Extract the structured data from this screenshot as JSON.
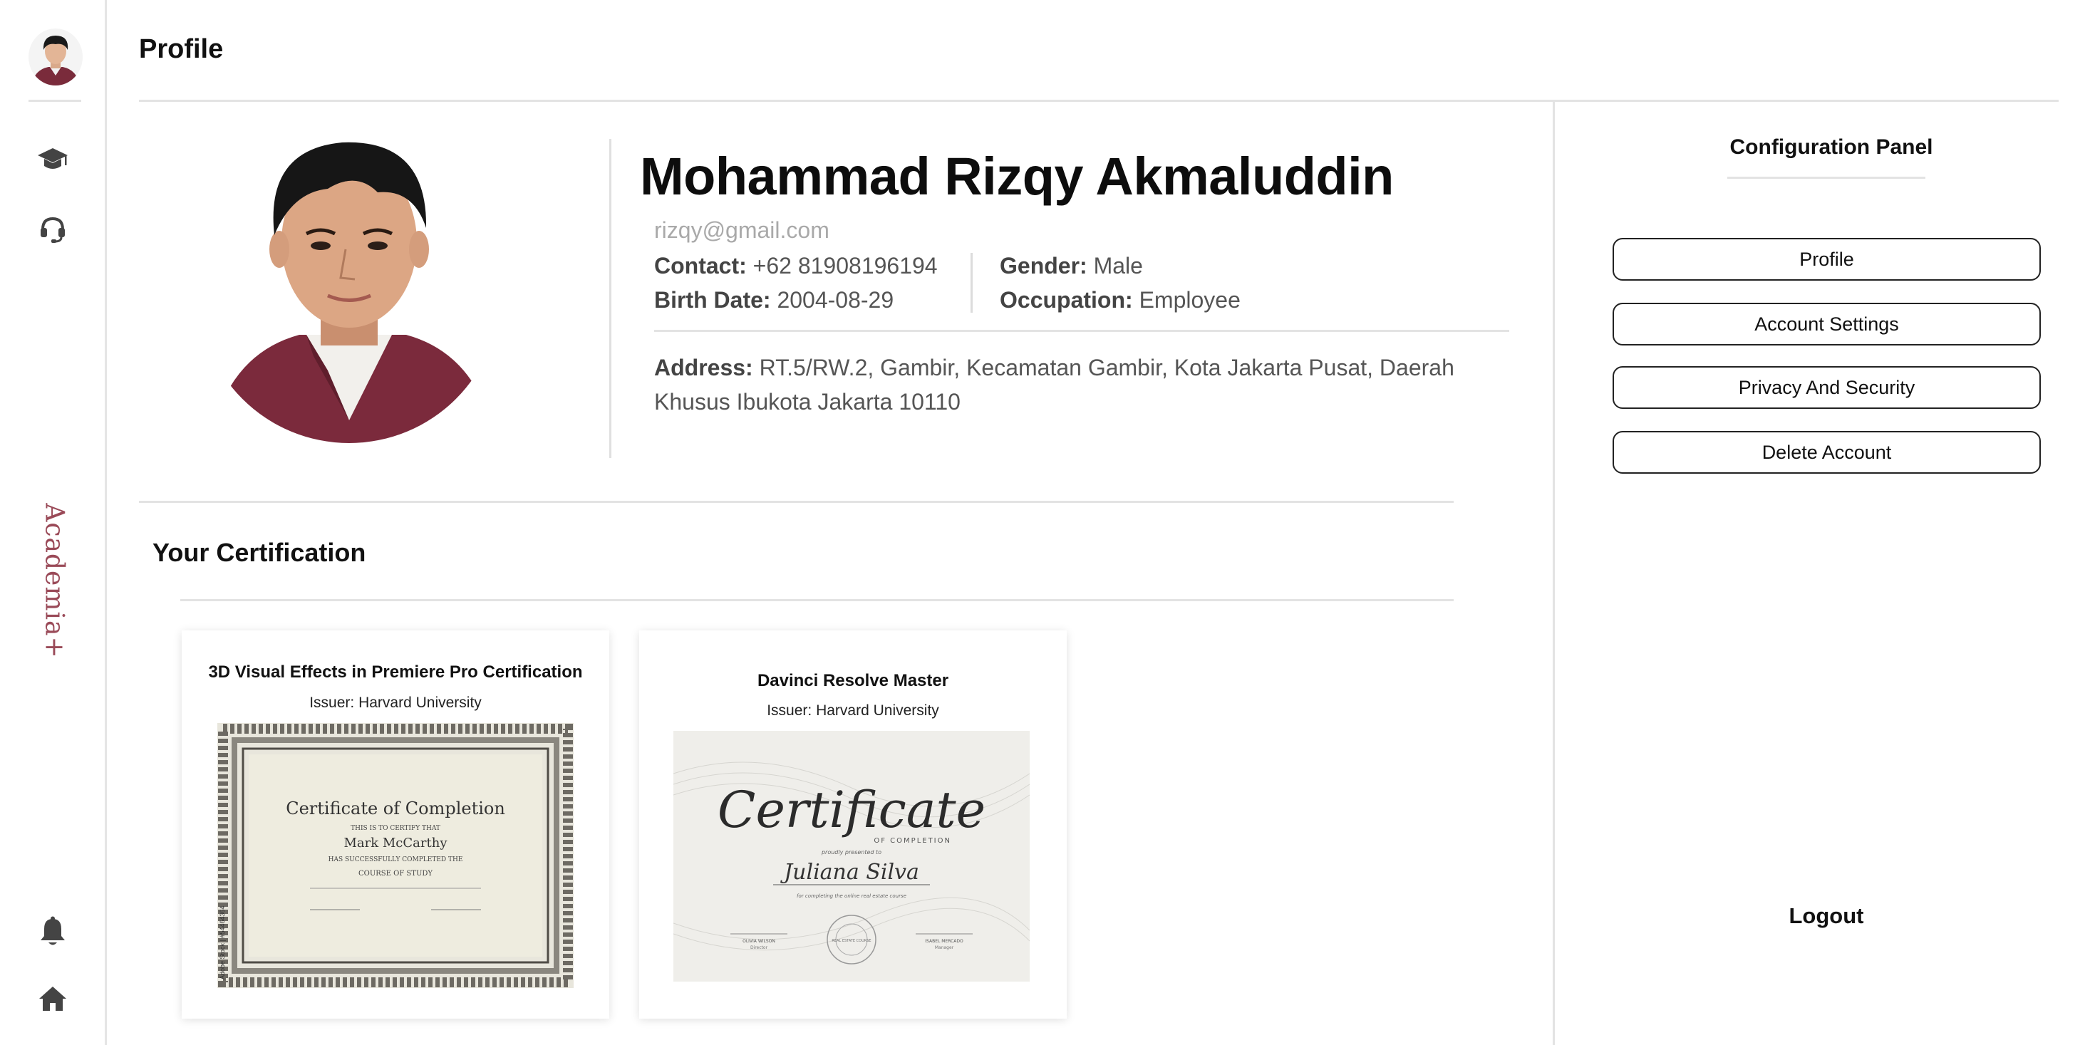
{
  "rail": {
    "icons": [
      "graduation-cap-icon",
      "headset-icon",
      "bell-icon",
      "home-icon"
    ],
    "brand": "Academia+",
    "brand_color": "#9a4a58"
  },
  "header": {
    "title": "Profile"
  },
  "profile": {
    "name": "Mohammad Rizqy Akmaluddin",
    "email": "rizqy@gmail.com",
    "contact_label": "Contact:",
    "contact_value": "+62 81908196194",
    "birth_label": "Birth Date:",
    "birth_value": "2004-08-29",
    "gender_label": "Gender:",
    "gender_value": "Male",
    "occupation_label": "Occupation:",
    "occupation_value": "Employee",
    "address_label": "Address:",
    "address_value": "RT.5/RW.2, Gambir, Kecamatan Gambir, Kota Jakarta Pusat, Daerah Khusus Ibukota Jakarta 10110"
  },
  "certifications": {
    "heading": "Your Certification",
    "items": [
      {
        "title": "3D Visual Effects in Premiere Pro Certification",
        "issuer": "Issuer: Harvard University",
        "image": {
          "heading": "Certificate of Completion",
          "certify": "THIS IS TO CERTIFY THAT",
          "recipient": "Mark McCarthy",
          "completed": "HAS SUCCESSFULLY COMPLETED THE",
          "course": "COURSE OF STUDY",
          "side_text": "Adobe Stock | #54464364"
        }
      },
      {
        "title": "Davinci Resolve Master",
        "issuer": "Issuer: Harvard University",
        "image": {
          "heading": "Certificate",
          "sub": "OF COMPLETION",
          "presented": "proudly presented to",
          "recipient": "Juliana Silva",
          "reason": "for completing the online real estate course",
          "sign_left": "OLIVIA WILSON",
          "sign_left_role": "Director",
          "sign_right": "ISABEL MERCADO",
          "sign_right_role": "Manager",
          "seal": "REAL ESTATE COURSE"
        }
      }
    ]
  },
  "panel": {
    "title": "Configuration Panel",
    "buttons": [
      "Profile",
      "Account Settings",
      "Privacy And Security",
      "Delete Account"
    ],
    "logout": "Logout"
  }
}
